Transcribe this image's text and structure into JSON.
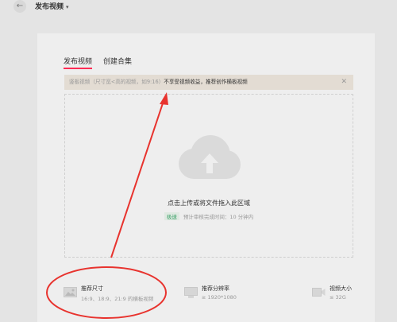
{
  "header": {
    "back_icon": "←",
    "title": "发布视频",
    "title_caret": "▾"
  },
  "tabs": [
    {
      "label": "发布视频",
      "active": true
    },
    {
      "label": "创建合集",
      "active": false
    }
  ],
  "notice": {
    "muted_text": "竖板视频（尺寸宽<高的视频，如9:16）",
    "main_text": "不享受视频收益，推荐创作横板视频",
    "close_icon": "✕"
  },
  "upload": {
    "main_text": "点击上传或将文件拖入此区域",
    "fast_badge": "极速",
    "sub_text": "预计审核完成时间：10 分钟内"
  },
  "specs": [
    {
      "title": "推荐尺寸",
      "desc": "16:9、18:9、21:9 的横板视频",
      "icon": "image-icon"
    },
    {
      "title": "推荐分辨率",
      "desc": "≥ 1920*1080",
      "icon": "monitor-icon"
    },
    {
      "title": "视频大小",
      "desc": "≤ 32G",
      "icon": "video-camera-icon"
    }
  ],
  "colors": {
    "accent": "#fe2c55",
    "annotation": "#e8332e",
    "fast_badge": "#3fa36b"
  }
}
